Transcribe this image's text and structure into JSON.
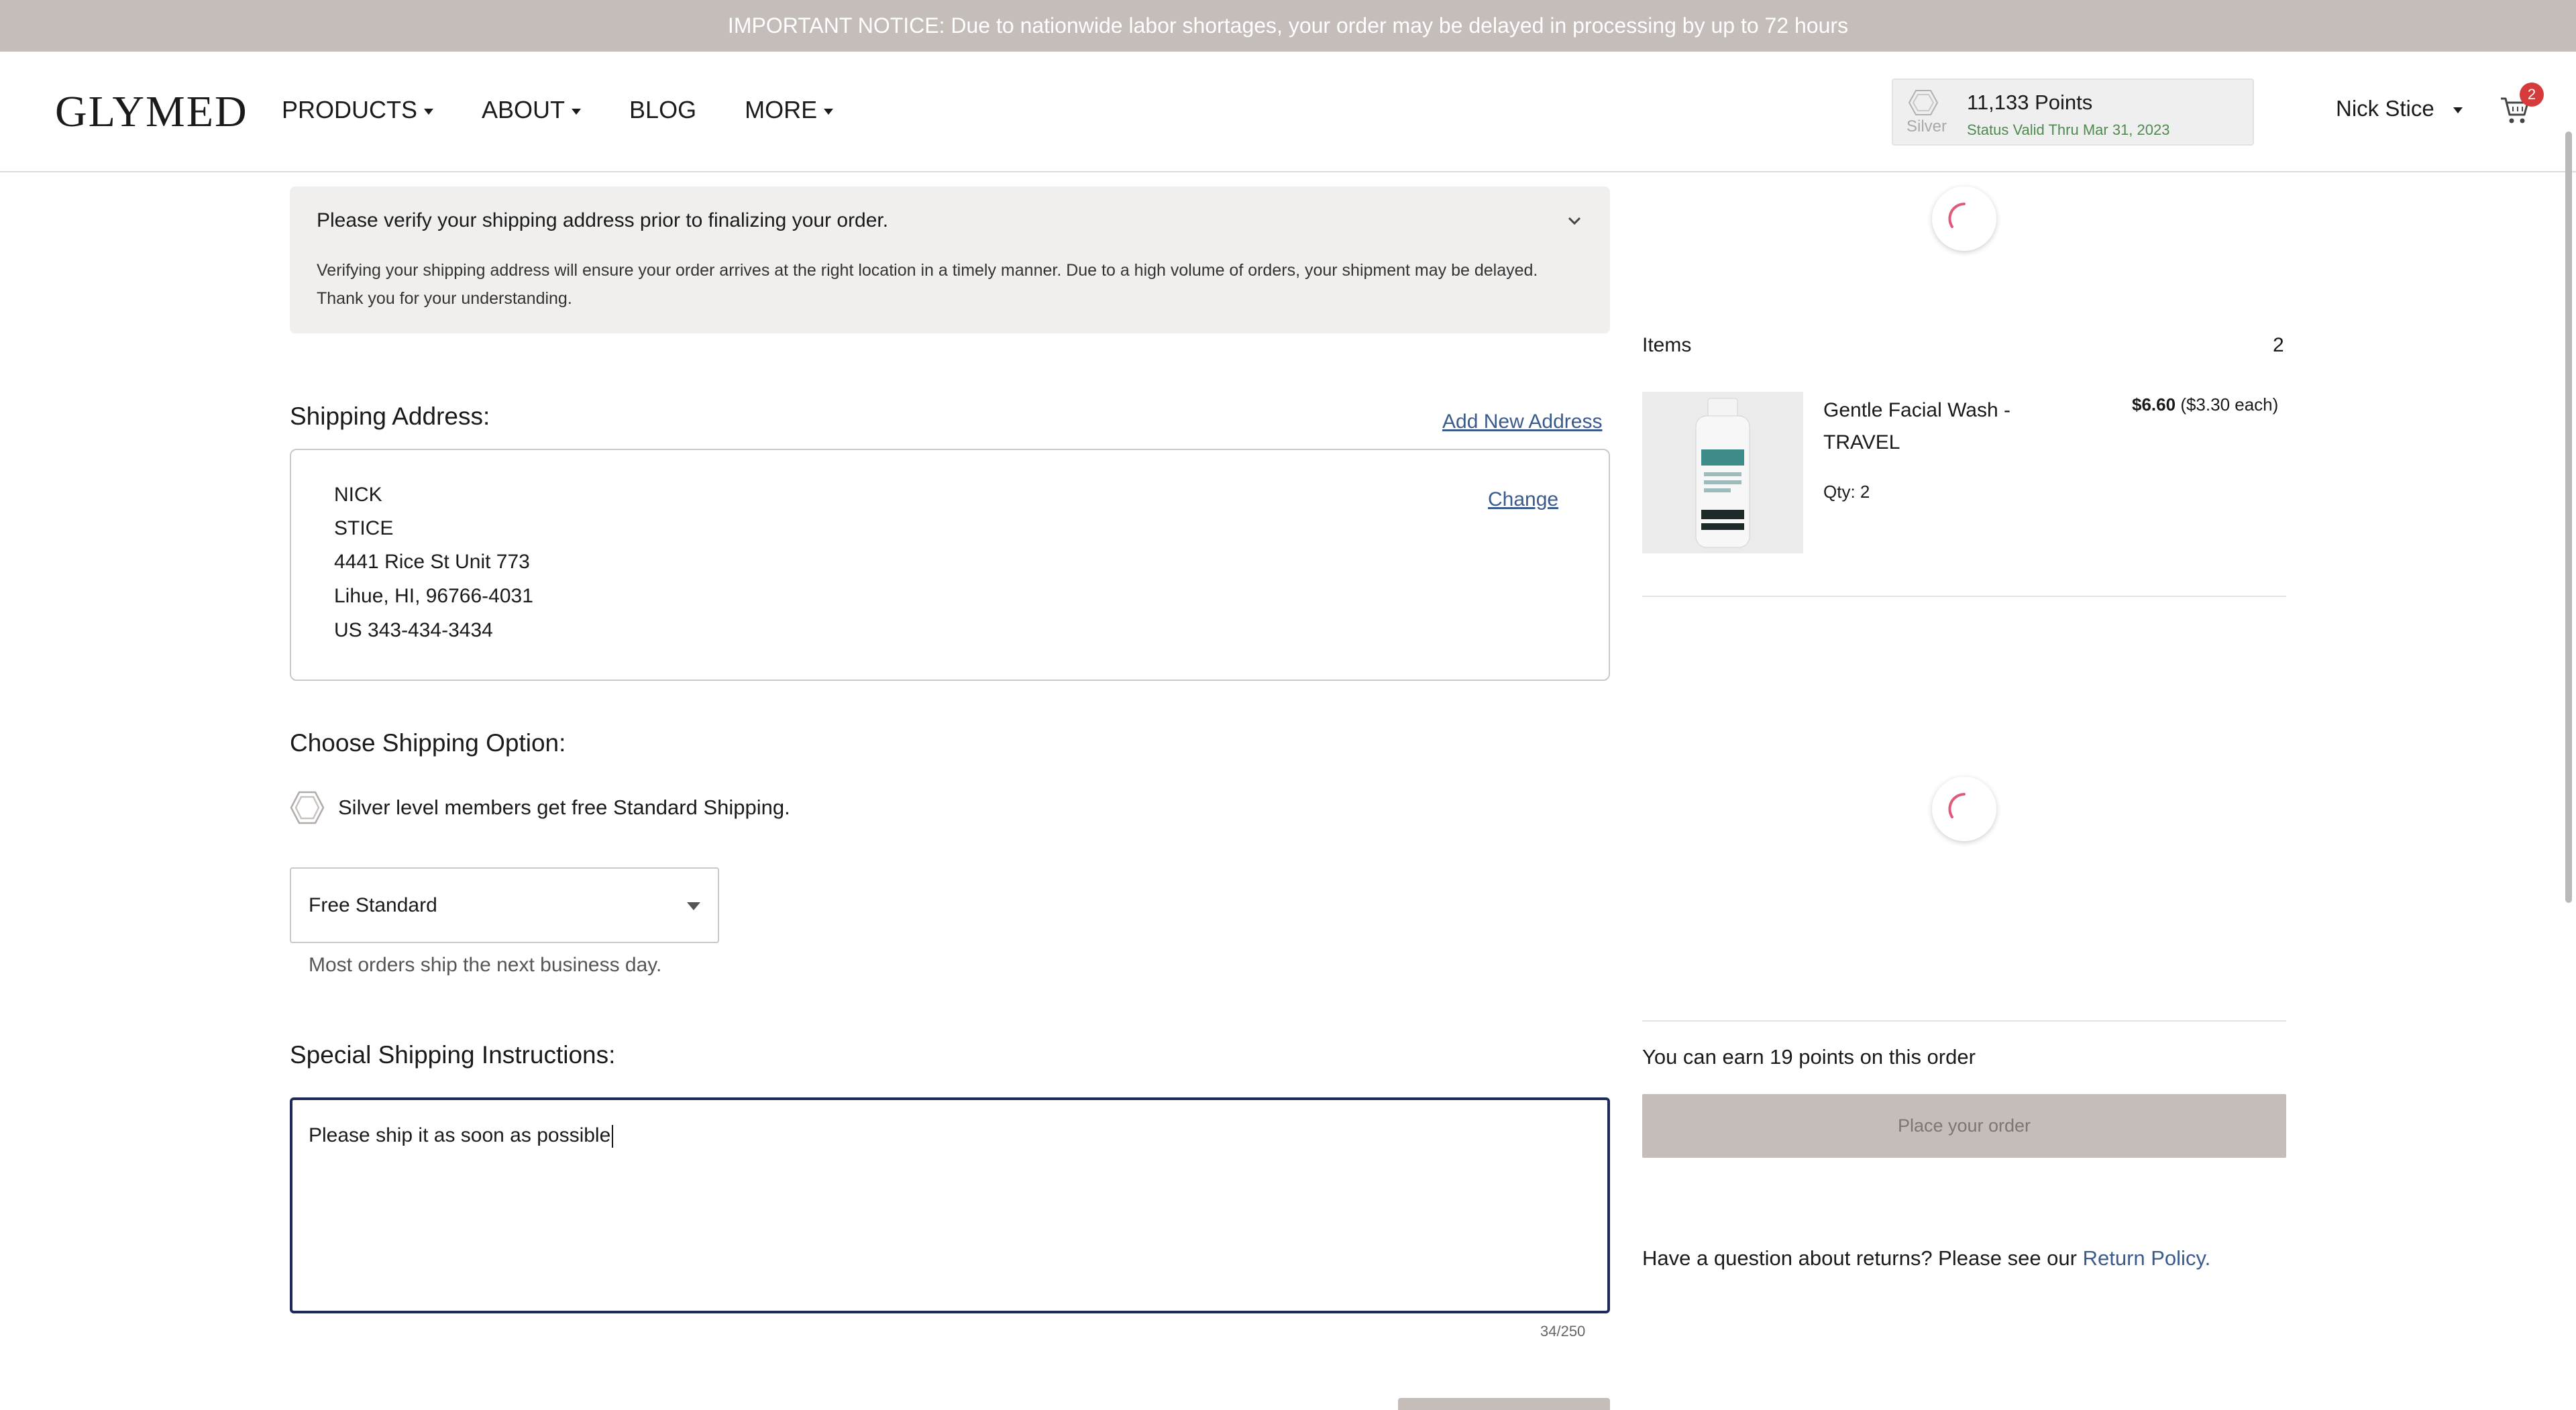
{
  "notice": {
    "text": "IMPORTANT NOTICE: Due to nationwide labor shortages, your order may be delayed in processing by up to 72 hours"
  },
  "header": {
    "logo": "GLYMED",
    "nav": [
      {
        "label": "PRODUCTS",
        "has_dropdown": true
      },
      {
        "label": "ABOUT",
        "has_dropdown": true
      },
      {
        "label": "BLOG",
        "has_dropdown": false
      },
      {
        "label": "MORE",
        "has_dropdown": true
      }
    ],
    "points": {
      "tier": "Silver",
      "value": "11,133 Points",
      "status": "Status Valid Thru Mar 31, 2023"
    },
    "user_name": "Nick Stice",
    "cart_count": "2"
  },
  "verify": {
    "title": "Please verify your shipping address prior to finalizing your order.",
    "body": "Verifying your shipping address will ensure your order arrives at the right location in a timely manner. Due to a high volume of orders, your shipment may be delayed. Thank you for your understanding."
  },
  "shipping_address": {
    "title": "Shipping Address:",
    "add_new_label": "Add New Address",
    "change_label": "Change",
    "lines": [
      "NICK",
      "STICE",
      "4441 Rice St Unit 773",
      "Lihue, HI, 96766-4031",
      "US 343-434-3434"
    ]
  },
  "shipping_option": {
    "title": "Choose Shipping Option:",
    "tier_note": "Silver level members get free Standard Shipping.",
    "selected": "Free Standard",
    "help": "Most orders ship the next business day."
  },
  "instructions": {
    "title": "Special Shipping Instructions:",
    "value": "Please ship it as soon as possible",
    "char_count": "34/250"
  },
  "summary": {
    "items_label": "Items",
    "items_count": "2",
    "product": {
      "name": "Gentle Facial Wash - TRAVEL",
      "qty": "Qty: 2",
      "price": "$6.60",
      "each": "($3.30 each)"
    },
    "earn_text": "You can earn 19 points on this order",
    "place_order_label": "Place your order",
    "returns_text": "Have a question about returns? Please see our ",
    "returns_link": "Return Policy."
  },
  "colors": {
    "notice_bg": "#c4bdba",
    "link": "#3a5a8c",
    "spinner": "#e05a7a",
    "badge": "#d63b3b",
    "textarea_border": "#1d2a5a"
  }
}
